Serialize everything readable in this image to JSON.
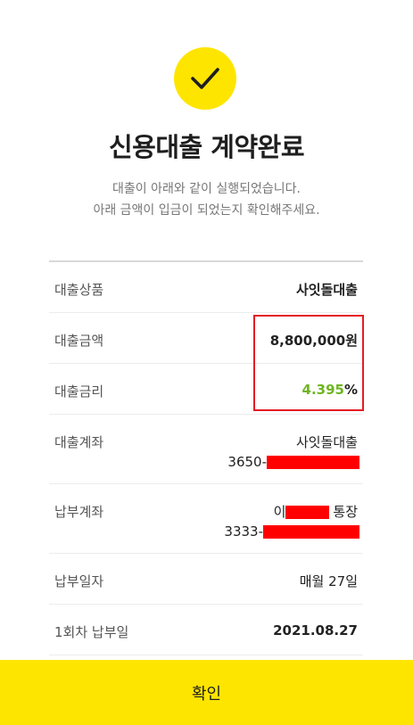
{
  "header": {
    "icon": "check-icon",
    "accent_color": "#fee500",
    "title": "신용대출 계약완료",
    "subtitle_line1": "대출이 아래와 같이 실행되었습니다.",
    "subtitle_line2": "아래 금액이 입금이 되었는지 확인해주세요."
  },
  "details": {
    "product": {
      "label": "대출상품",
      "value": "사잇돌대출"
    },
    "amount": {
      "label": "대출금액",
      "value": "8,800,000원"
    },
    "rate": {
      "label": "대출금리",
      "value": "4.395",
      "unit": "%",
      "color": "#6eb521"
    },
    "loan_account": {
      "label": "대출계좌",
      "value_line1": "사잇돌대출",
      "value_line2_prefix": "3650-"
    },
    "repay_account": {
      "label": "납부계좌",
      "value_line1_prefix": "이",
      "value_line1_suffix": "통장",
      "value_line2_prefix": "3333-"
    },
    "repay_day": {
      "label": "납부일자",
      "value": "매월 27일"
    },
    "first_payment": {
      "label": "1회차 납부일",
      "value": "2021.08.27",
      "color": "#1b4b80"
    }
  },
  "confirm_button": {
    "label": "확인"
  }
}
